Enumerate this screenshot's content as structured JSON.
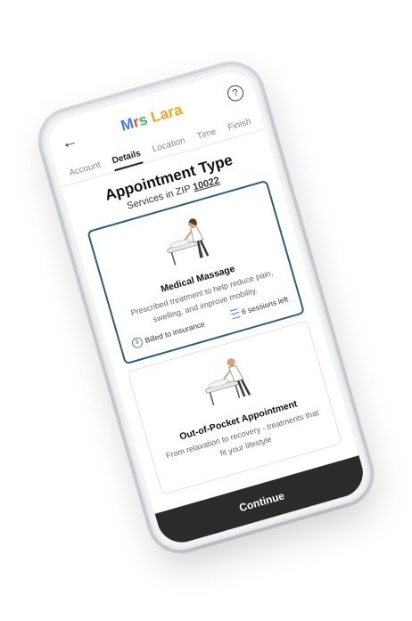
{
  "brand": {
    "part1": "M",
    "part2": "r",
    "part3": "s ",
    "part4": "Lara"
  },
  "tabs": [
    {
      "label": "Account"
    },
    {
      "label": "Details"
    },
    {
      "label": "Location"
    },
    {
      "label": "Time"
    },
    {
      "label": "Finish"
    }
  ],
  "page": {
    "title": "Appointment Type",
    "subtitle_prefix": "Services in ZIP ",
    "zip": "10022"
  },
  "options": [
    {
      "title": "Medical Massage",
      "description": "Prescribed treatment to help reduce pain, swelling, and improve mobility.",
      "billing": "Billed to insurance",
      "sessions": "6 sessions left",
      "selected": true
    },
    {
      "title": "Out-of-Pocket Appointment",
      "description": "From relaxation to recovery - treatments that fit your lifestyle",
      "selected": false
    }
  ],
  "footer": {
    "continue_label": "Continue"
  },
  "colors": {
    "selected_border": "#2f5d7a",
    "button": "#2b2b2b"
  }
}
